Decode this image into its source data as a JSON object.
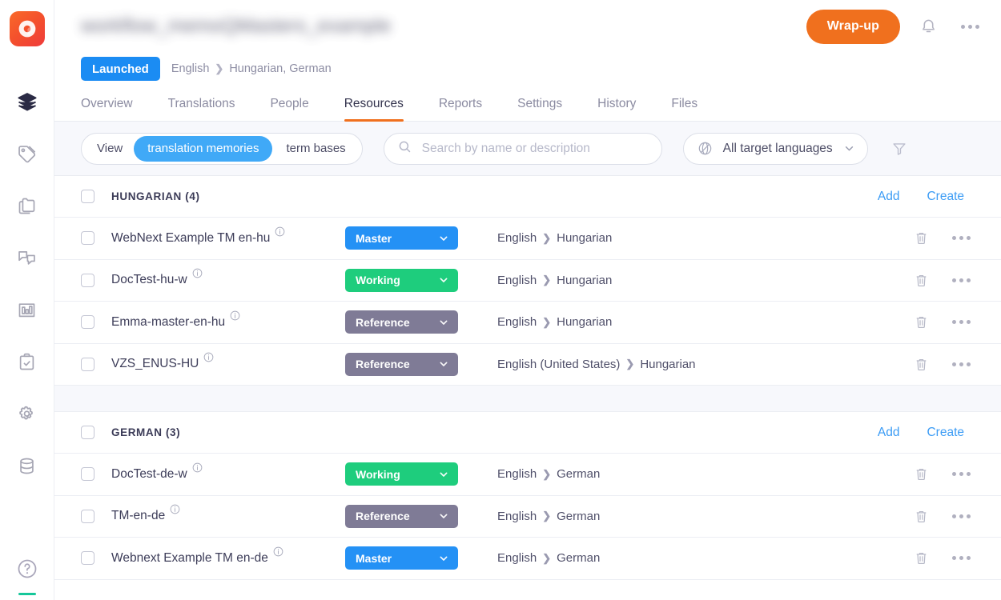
{
  "app": {
    "logo_icon": "qordoba-logo-icon",
    "help_icon": "help-circle-icon"
  },
  "sidebar": {
    "items": [
      {
        "label": "Projects",
        "icon": "layers-icon",
        "active": true
      },
      {
        "label": "Tags",
        "icon": "tag-icon",
        "active": false
      },
      {
        "label": "Files",
        "icon": "folders-icon",
        "active": false
      },
      {
        "label": "Messages",
        "icon": "chat-bubbles-icon",
        "active": false
      },
      {
        "label": "Analytics",
        "icon": "bar-chart-icon",
        "active": false
      },
      {
        "label": "Tasks",
        "icon": "clipboard-check-icon",
        "active": false
      },
      {
        "label": "Settings",
        "icon": "gear-icon",
        "active": false
      },
      {
        "label": "Database",
        "icon": "database-icon",
        "active": false
      }
    ]
  },
  "header": {
    "project_title": "workflow_memoQMasters_example",
    "wrap_up_label": "Wrap-up",
    "bell_icon": "bell-icon",
    "more_icon": "more-horizontal-icon",
    "status_badge": "Launched",
    "breadcrumb": {
      "source": "English",
      "separator": "❯",
      "targets": "Hungarian, German"
    }
  },
  "tabs": [
    {
      "label": "Overview",
      "active": false
    },
    {
      "label": "Translations",
      "active": false
    },
    {
      "label": "People",
      "active": false
    },
    {
      "label": "Resources",
      "active": true
    },
    {
      "label": "Reports",
      "active": false
    },
    {
      "label": "Settings",
      "active": false
    },
    {
      "label": "History",
      "active": false
    },
    {
      "label": "Files",
      "active": false
    }
  ],
  "toolbar": {
    "view_label": "View",
    "view_options": [
      {
        "label": "translation memories",
        "active": true
      },
      {
        "label": "term bases",
        "active": false
      }
    ],
    "search": {
      "placeholder": "Search by name or description",
      "value": "",
      "icon": "search-icon"
    },
    "language_filter": {
      "label": "All target languages",
      "icon": "globe-icon",
      "chevron": "chevron-down-icon"
    },
    "filter_icon": "funnel-icon"
  },
  "table": {
    "group_actions": {
      "add": "Add",
      "create": "Create"
    },
    "row_icons": {
      "info": "info-circle-icon",
      "delete": "trash-icon",
      "more": "more-horizontal-icon"
    },
    "groups": [
      {
        "name": "HUNGARIAN (4)",
        "rows": [
          {
            "name": "WebNext Example TM en-hu",
            "status": "Master",
            "status_color": "#2491f5",
            "source": "English",
            "target": "Hungarian"
          },
          {
            "name": "DocTest-hu-w",
            "status": "Working",
            "status_color": "#1ecd7d",
            "source": "English",
            "target": "Hungarian"
          },
          {
            "name": "Emma-master-en-hu",
            "status": "Reference",
            "status_color": "#7f7b96",
            "source": "English",
            "target": "Hungarian"
          },
          {
            "name": "VZS_ENUS-HU",
            "status": "Reference",
            "status_color": "#7f7b96",
            "source": "English (United States)",
            "target": "Hungarian"
          }
        ]
      },
      {
        "name": "GERMAN (3)",
        "rows": [
          {
            "name": "DocTest-de-w",
            "status": "Working",
            "status_color": "#1ecd7d",
            "source": "English",
            "target": "German"
          },
          {
            "name": "TM-en-de",
            "status": "Reference",
            "status_color": "#7f7b96",
            "source": "English",
            "target": "German"
          },
          {
            "name": "Webnext Example TM en-de",
            "status": "Master",
            "status_color": "#2491f5",
            "source": "English",
            "target": "German"
          }
        ]
      }
    ]
  },
  "colors": {
    "brand_orange": "#f0701e",
    "accent_blue": "#1b8cf3",
    "link_blue": "#3c9cf5",
    "status_master": "#2491f5",
    "status_working": "#1ecd7d",
    "status_reference": "#7f7b96",
    "toolbar_bg": "#f7f8fc"
  }
}
